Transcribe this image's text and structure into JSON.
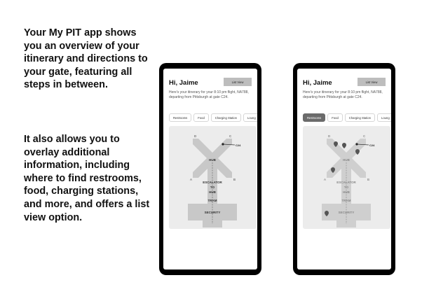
{
  "description": {
    "paragraph1": "Your My PIT app shows you an overview of your itinerary and directions to your gate, featuring all steps in between.",
    "paragraph2": "It also allows you to overlay additional information, including where to find restrooms, food, charging stations, and more, and offers a list view option."
  },
  "app": {
    "greeting": "Hi, Jaime",
    "list_view_label": "List View",
    "itinerary": "Here's your itinerary for your 8:10 pm flight, NA788, departing from Pittsburgh at gate C24.",
    "filters": [
      "Restrooms",
      "Food",
      "Charging Station",
      "Loung"
    ],
    "map": {
      "concourse_labels": {
        "a": "A",
        "b": "B",
        "c": "C",
        "d": "D"
      },
      "hub_label": "HUB",
      "gate_label": "C24",
      "escalator_lines": [
        "ESCALATOR",
        "TO",
        "HUB"
      ],
      "tram_label": "TRAM",
      "security_label": "SECURITY"
    }
  },
  "screens": [
    {
      "active_filter": null,
      "pins_visible": false
    },
    {
      "active_filter": "Restrooms",
      "pins_visible": true
    }
  ],
  "colors": {
    "phone_frame": "#000000",
    "map_background": "#ececec",
    "building": "#c8c8c8",
    "active_chip": "#6b6b6b",
    "list_button": "#bdbdbd",
    "pin": "#555555"
  }
}
